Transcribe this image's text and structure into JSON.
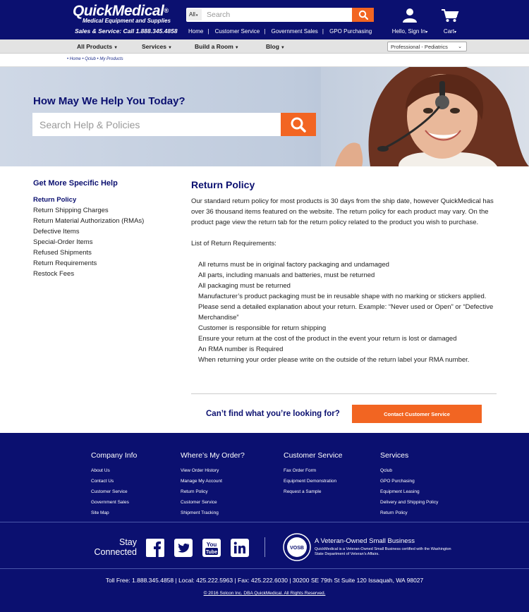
{
  "header": {
    "brand": "QuickMedical",
    "brand_mark": "®",
    "tagline": "Medical Equipment and Supplies",
    "phone": "Sales & Service: Call 1.888.345.4858",
    "search_scope": "All",
    "search_placeholder": "Search",
    "nav": [
      "Home",
      "Customer Service",
      "Government Sales",
      "GPO Purchasing"
    ],
    "account_label": "Hello, Sign In",
    "cart_label": "Cart"
  },
  "catbar": {
    "items": [
      "All Products",
      "Services",
      "Build a Room",
      "Blog"
    ],
    "profile_select": "Professional - Pediatrics"
  },
  "breadcrumb": "• Home • Qclub • My Products",
  "hero": {
    "heading": "How May We Help You Today?",
    "search_placeholder": "Search Help & Policies"
  },
  "sidebar": {
    "title": "Get More Specific Help",
    "items": [
      "Return Policy",
      "Return Shipping Charges",
      "Return Material Authorization (RMAs)",
      "Defective Items",
      "Special-Order Items",
      "Refused Shipments",
      "Return Requirements",
      "Restock Fees"
    ]
  },
  "main": {
    "title": "Return Policy",
    "intro": "Our standard return policy for most products is 30 days from the ship date, however QuickMedical has over 36 thousand items featured on the website. The return policy for each product may vary. On the product page view the return tab for the return policy related to the product you wish to purchase.",
    "list_heading": "List of Return Requirements:",
    "requirements": [
      "All returns must be in original factory packaging and undamaged",
      "All parts, including manuals and batteries, must be returned",
      "All packaging must be returned",
      "Manufacturer’s product packaging must be in reusable shape with no marking or stickers applied.",
      "Please send a detailed explanation about your return. Example: “Never used or Open” or “Defective Merchandise”",
      "Customer is responsible for return shipping",
      "Ensure your return at the cost of the product in the event your return is lost or damaged",
      "An RMA number is Required",
      "When returning your order please write on the outside of the return label your RMA number."
    ],
    "cta_text": "Can’t find what you’re looking for?",
    "cta_button": "Contact Customer Service"
  },
  "footer": {
    "columns": [
      {
        "title": "Company Info",
        "links": [
          "About Us",
          "Contact Us",
          "Customer Service",
          "Government Sales",
          "Site Map"
        ]
      },
      {
        "title": "Where’s My Order?",
        "links": [
          "View Order History",
          "Manage My Account",
          "Return Policy",
          "Customer Service",
          "Shipment Tracking"
        ]
      },
      {
        "title": "Customer Service",
        "links": [
          "Fax Order Form",
          "Equipment Demonstration",
          "Request a Sample"
        ]
      },
      {
        "title": "Services",
        "links": [
          "Qclub",
          "GPO Purchasing",
          "Equipment Leasing",
          "Delivery and Shipping Policy",
          "Return Policy"
        ]
      }
    ],
    "stay_line1": "Stay",
    "stay_line2": "Connected",
    "vosb_badge": "VOSB",
    "vet_title": "A Veteran-Owned Small Business",
    "vet_desc": "QuickMedical is a Veteran-Owned Small Business certified with the Washington State Department of Veteran’s Affairs.",
    "contact_line": "Toll Free: 1.888.345.4858  |  Local: 425.222.5963  |  Fax: 425.222.6030  |  30200 SE 79th St Suite 120 Issaquah, WA 98027",
    "copyright": "© 2016 Solcon Inc. DBA QuickMedical. All Rights Reserved."
  },
  "colors": {
    "navy": "#0b1070",
    "orange": "#f26522"
  }
}
